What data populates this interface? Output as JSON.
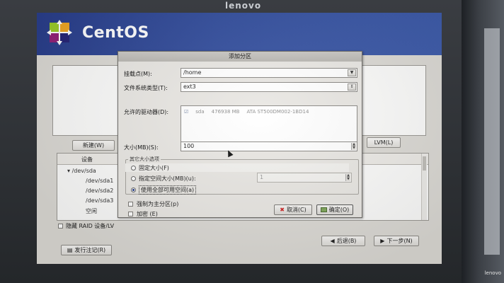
{
  "monitor": {
    "brand": "lenovo",
    "corner_tag": "lenovo"
  },
  "header": {
    "logo_text": "CentOS"
  },
  "installer": {
    "new_button": "新建(W)",
    "lvm_button": "LVM(L)",
    "tree_header": "设备",
    "devices": [
      "/dev/sda",
      "/dev/sda1",
      "/dev/sda2",
      "/dev/sda3",
      "空闲"
    ],
    "hide_raid_label": "隐藏 RAID 设备/LV",
    "release_button": "发行注记(R)",
    "back_button": "后退(B)",
    "next_button": "下一步(N)"
  },
  "dialog": {
    "title": "添加分区",
    "mount_point_label": "挂载点(M):",
    "mount_point_value": "/home",
    "fs_type_label": "文件系统类型(T):",
    "fs_type_value": "ext3",
    "allowed_drives_label": "允许的驱动器(D):",
    "drive": {
      "name": "sda",
      "size": "476938 MB",
      "model": "ATA ST500DM002-1BD14"
    },
    "size_label": "大小(MB)(S):",
    "size_value": "100",
    "size_options_label": "其它大小选项",
    "opt_fixed": "固定大小(F)",
    "opt_max": "指定空间大小(MB)(u):",
    "opt_max_value": "1",
    "opt_fill": "使用全部可用空间(a)",
    "primary_label": "强制为主分区(p)",
    "encrypt_label": "加密 (E)",
    "cancel_button": "取消(C)",
    "ok_button": "确定(O)"
  },
  "colors": {
    "header_blue": "#344f9e",
    "dialog_bg": "#e9e7e3"
  }
}
